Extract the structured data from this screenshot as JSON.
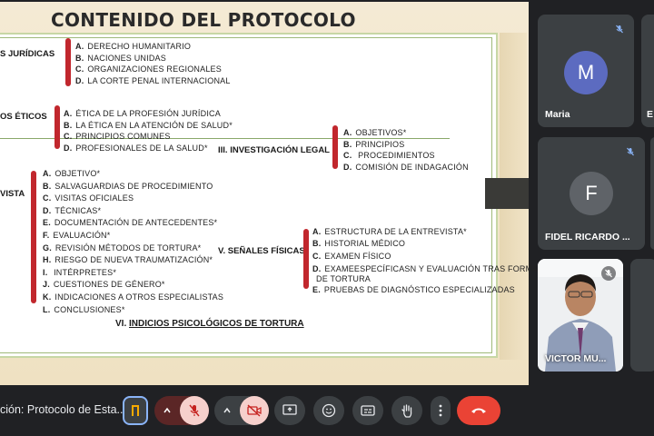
{
  "slide": {
    "title": "CONTENIDO DEL PROTOCOLO",
    "sections": {
      "juridicas": {
        "label": "S JURÍDICAS",
        "items": [
          {
            "letter": "A.",
            "text": "DERECHO HUMANITARIO"
          },
          {
            "letter": "B.",
            "text": "NACIONES UNIDAS"
          },
          {
            "letter": "C.",
            "text": "ORGANIZACIONES REGIONALES"
          },
          {
            "letter": "D.",
            "text": "LA CORTE PENAL INTERNACIONAL"
          }
        ]
      },
      "eticos": {
        "label": "OS ÉTICOS",
        "items": [
          {
            "letter": "A.",
            "text": "ÉTICA DE LA PROFESIÓN JURÍDICA"
          },
          {
            "letter": "B.",
            "text": "LA ÉTICA EN LA ATENCIÓN DE SALUD*"
          },
          {
            "letter": "C.",
            "text": "PRINCIPIOS COMUNES"
          },
          {
            "letter": "D.",
            "text": "PROFESIONALES DE LA SALUD*"
          }
        ]
      },
      "investigacion": {
        "label": "III. INVESTIGACIÓN LEGAL",
        "items": [
          {
            "letter": "A.",
            "text": "OBJETIVOS*"
          },
          {
            "letter": "B.",
            "text": "PRINCIPIOS"
          },
          {
            "letter": "C.",
            "text": " PROCEDIMIENTOS"
          },
          {
            "letter": "D.",
            "text": "COMISIÓN DE INDAGACIÓN"
          }
        ]
      },
      "entrevista": {
        "label": "VISTA",
        "items": [
          {
            "letter": "A.",
            "text": "OBJETIVO*"
          },
          {
            "letter": "B.",
            "text": "SALVAGUARDIAS DE PROCEDIMIENTO"
          },
          {
            "letter": "C.",
            "text": "VISITAS OFICIALES"
          },
          {
            "letter": "D.",
            "text": "TÉCNICAS*"
          },
          {
            "letter": "E.",
            "text": "DOCUMENTACIÓN DE ANTECEDENTES*"
          },
          {
            "letter": "F.",
            "text": "EVALUACIÓN*"
          },
          {
            "letter": "G.",
            "text": "REVISIÓN MÉTODOS DE TORTURA*"
          },
          {
            "letter": "H.",
            "text": "RIESGO DE NUEVA TRAUMATIZACIÓN*"
          },
          {
            "letter": "I.",
            "text": " INTÉRPRETES*"
          },
          {
            "letter": "J.",
            "text": "CUESTIONES DE GÉNERO*"
          },
          {
            "letter": "K.",
            "text": "INDICACIONES A OTROS ESPECIALISTAS"
          },
          {
            "letter": "L.",
            "text": "CONCLUSIONES*"
          }
        ]
      },
      "senales": {
        "label": "V. SEÑALES FÍSICAS",
        "items": [
          {
            "letter": "A.",
            "text": "ESTRUCTURA DE LA ENTREVISTA*"
          },
          {
            "letter": "B.",
            "text": "HISTORIAL MÉDICO"
          },
          {
            "letter": "C.",
            "text": "EXAMEN FÍSICO"
          },
          {
            "letter": "D.",
            "text": "EXAMEESPECÍFICASN Y EVALUACIÓN TRAS FORMAS"
          },
          {
            "letter": "",
            "text": "DE TORTURA"
          },
          {
            "letter": "E.",
            "text": "PRUEBAS DE DIAGNÓSTICO ESPECIALIZADAS"
          }
        ]
      },
      "indicios": {
        "prefix": "VI.",
        "label": "INDICIOS PSICOLÓGICOS DE TORTURA"
      }
    }
  },
  "participants": [
    {
      "name": "Maria",
      "initial": "M",
      "avatar_color": "#5c6bc0",
      "muted": true
    },
    {
      "name": "FIDEL RICARDO ...",
      "initial": "F",
      "avatar_color": "#5f6368",
      "muted": true
    },
    {
      "name": "VICTOR MU...",
      "initial": "",
      "muted": true
    },
    {
      "name": "E",
      "initial": "",
      "muted": true
    }
  ],
  "toolbar": {
    "meeting_title": "ción: Protocolo de Esta...",
    "buttons": [
      {
        "name": "companion-mode",
        "icon": "door-icon"
      },
      {
        "name": "audio-options",
        "icon": "chevron-up-icon"
      },
      {
        "name": "mic-toggle",
        "icon": "mic-off-icon"
      },
      {
        "name": "video-options",
        "icon": "chevron-up-icon"
      },
      {
        "name": "camera-toggle",
        "icon": "camera-off-icon"
      },
      {
        "name": "present",
        "icon": "present-icon"
      },
      {
        "name": "reactions",
        "icon": "emoji-icon"
      },
      {
        "name": "captions",
        "icon": "captions-icon"
      },
      {
        "name": "raise-hand",
        "icon": "hand-icon"
      },
      {
        "name": "more-options",
        "icon": "more-vert-icon"
      },
      {
        "name": "leave-call",
        "icon": "phone-hangup-icon"
      }
    ],
    "colors": {
      "danger": "#ea4335",
      "muted_bg": "#f6d0cc",
      "muted_icon": "#c5221f",
      "accent": "#8ab4f8"
    }
  }
}
